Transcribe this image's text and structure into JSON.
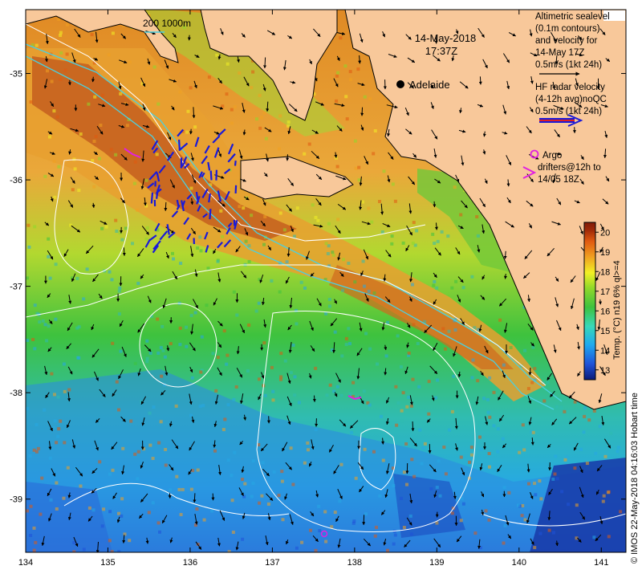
{
  "map": {
    "date": "14-May-2018",
    "time": "17:37Z",
    "city_label": "Adelaide",
    "depth_contours_label": "200  1000m",
    "credit": "© IMOS 22-May-2018 04:16:03 Hobart time",
    "colors": {
      "land": "#f8c89a",
      "coast": "#000000",
      "contour": "#ffffff",
      "bathymetry": "#4ad0e0",
      "radar_vectors": "#1a1ad8",
      "argo": "#e020e0"
    }
  },
  "legend": {
    "sealevel": [
      "Altimetric sealevel",
      "(0.1m contours)",
      "and velocity for",
      "14-May 17Z",
      "0.5m/s (1kt 24h)"
    ],
    "radar": [
      "HF radar velocity",
      "(4-12h avg)noQC",
      "0.5m/s (1kt 24h)"
    ],
    "argo": [
      "Argo",
      "drifters@12h to",
      "14/05 18Z"
    ]
  },
  "axes": {
    "x_ticks": [
      "134",
      "135",
      "136",
      "137",
      "138",
      "139",
      "140",
      "141"
    ],
    "x_values": [
      134,
      135,
      136,
      137,
      138,
      139,
      140,
      141
    ],
    "y_ticks": [
      "-35",
      "-36",
      "-37",
      "-38",
      "-39"
    ],
    "y_values": [
      -35,
      -36,
      -37,
      -38,
      -39
    ],
    "lon_range": [
      134,
      141.3
    ],
    "lat_range": [
      -39.5,
      -34.4
    ]
  },
  "colorbar": {
    "title": "Temp. (°C) n19 6% ql>=4",
    "ticks": [
      "20",
      "19",
      "18",
      "17",
      "16",
      "15",
      "14",
      "13"
    ],
    "values": [
      20,
      19,
      18,
      17,
      16,
      15,
      14,
      13
    ],
    "range": [
      12.5,
      20.5
    ],
    "stops": [
      "#0a1a78",
      "#1f52d8",
      "#1fa8ef",
      "#38d8b8",
      "#3ec23e",
      "#8ed82a",
      "#f2f024",
      "#f0a020",
      "#e05a10",
      "#a02a08",
      "#801c08"
    ]
  }
}
